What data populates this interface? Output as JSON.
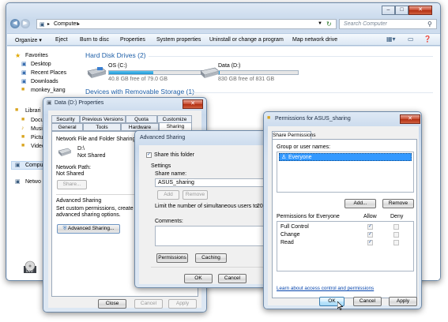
{
  "explorer": {
    "address": "Computer",
    "search_placeholder": "Search Computer",
    "toolbar": [
      "Organize ▾",
      "Eject",
      "Burn to disc",
      "Properties",
      "System properties",
      "Uninstall or change a program",
      "Map network drive"
    ],
    "nav": {
      "favorites": "Favorites",
      "fav_items": [
        "Desktop",
        "Recent Places",
        "Downloads",
        "monkey_kang"
      ],
      "libraries": "Librari",
      "lib_items": [
        "Docu",
        "Musi",
        "Pictu",
        "Video"
      ],
      "computer": "Compu",
      "network": "Netwo"
    },
    "hdd_header": "Hard Disk Drives (2)",
    "drives": [
      {
        "name": "OS (C:)",
        "free": "40.8 GB free of 79.0 GB",
        "used_fraction": 0.48
      },
      {
        "name": "Data (D:)",
        "free": "830 GB free of 831 GB",
        "used_fraction": 0.01
      }
    ],
    "removable_header": "Devices with Removable Storage (1)"
  },
  "props": {
    "title": "Data (D:) Properties",
    "tabs_row1": [
      "Security",
      "Previous Versions",
      "Quota",
      "Customize"
    ],
    "tabs_row2": [
      "General",
      "Tools",
      "Hardware",
      "Sharing"
    ],
    "nffs_title": "Network File and Folder Sharing",
    "drive": "D:\\",
    "state": "Not Shared",
    "network_path_label": "Network Path:",
    "network_path_value": "Not Shared",
    "share_btn": "Share...",
    "adv_title": "Advanced Sharing",
    "adv_desc1": "Set custom permissions, create multiple",
    "adv_desc2": "advanced sharing options.",
    "adv_btn": "Advanced Sharing...",
    "close": "Close",
    "cancel": "Cancel",
    "apply": "Apply"
  },
  "adv": {
    "title": "Advanced Sharing",
    "share_cb": "Share this folder",
    "settings": "Settings",
    "share_name_label": "Share name:",
    "share_name": "ASUS_sharing",
    "add": "Add",
    "remove": "Remove",
    "limit_label": "Limit the number of simultaneous users to:",
    "limit_value": "20",
    "comments": "Comments:",
    "permissions": "Permissions",
    "caching": "Caching",
    "ok": "OK",
    "cancel": "Cancel"
  },
  "perm": {
    "title": "Permissions for ASUS_sharing",
    "tab": "Share Permissions",
    "group_label": "Group or user names:",
    "user": "Everyone",
    "add": "Add...",
    "remove": "Remove",
    "perm_for": "Permissions for Everyone",
    "allow": "Allow",
    "deny": "Deny",
    "rows": [
      {
        "name": "Full Control",
        "allow": true,
        "deny": false
      },
      {
        "name": "Change",
        "allow": true,
        "deny": false
      },
      {
        "name": "Read",
        "allow": true,
        "deny": false
      }
    ],
    "link": "Learn about access control and permissions",
    "ok": "OK",
    "cancel": "Cancel",
    "apply": "Apply"
  },
  "colors": {
    "accent": "#1e5fa8",
    "selection": "#3399ff",
    "link": "#0645ad",
    "close_red": "#c74a2f"
  }
}
